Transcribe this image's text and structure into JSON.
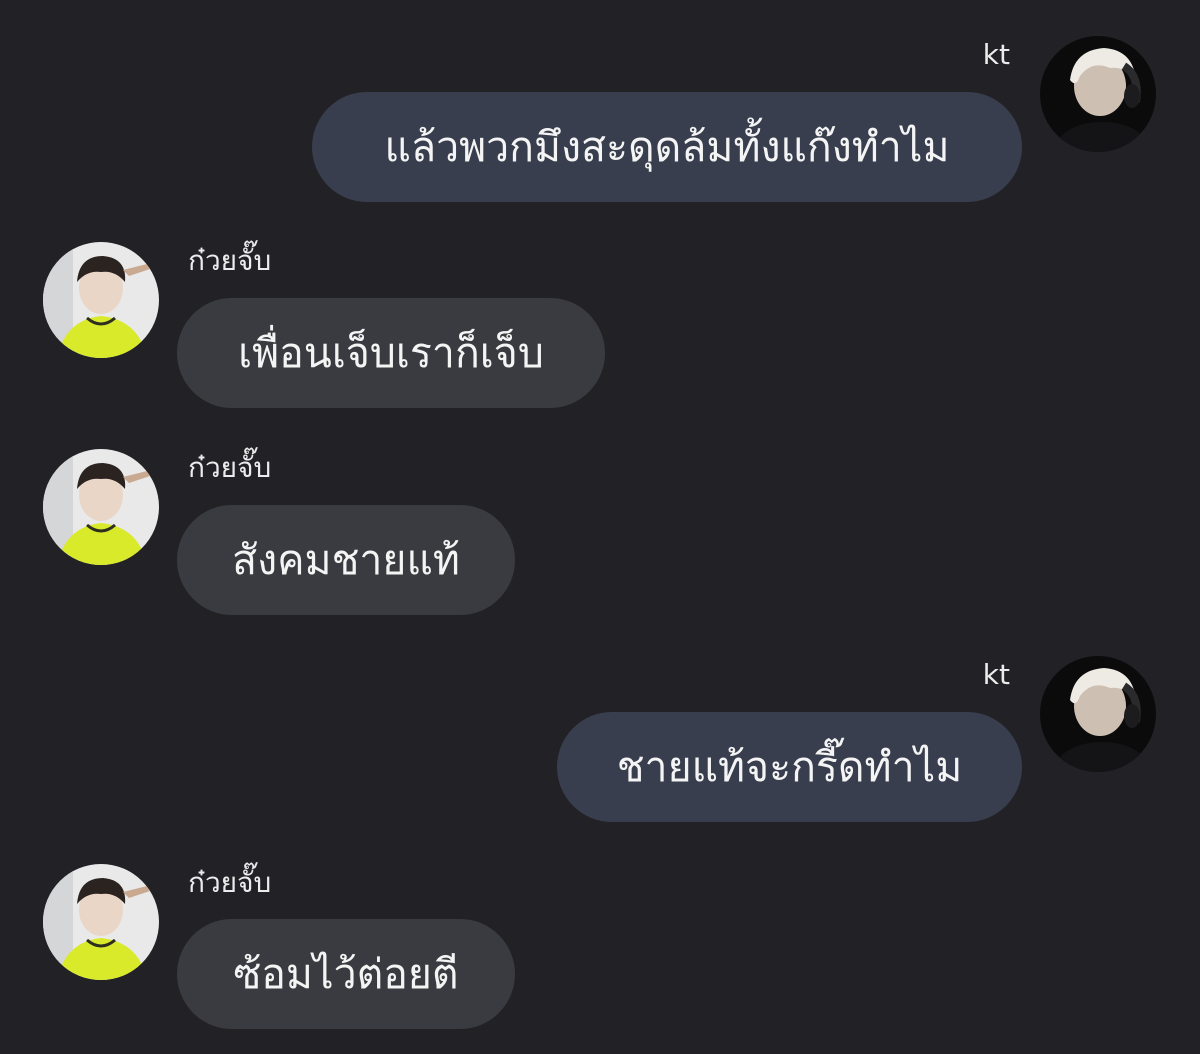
{
  "messages": [
    {
      "sender": "kt",
      "side": "right",
      "text": "แล้วพวกมึงสะดุดล้มทั้งแก๊งทำไม"
    },
    {
      "sender": "ก๋วยจั๊บ",
      "side": "left",
      "text": "เพื่อนเจ็บเราก็เจ็บ"
    },
    {
      "sender": "ก๋วยจั๊บ",
      "side": "left",
      "text": "สังคมชายแท้"
    },
    {
      "sender": "kt",
      "side": "right",
      "text": "ชายแท้จะกรี๊ดทำไม"
    },
    {
      "sender": "ก๋วยจั๊บ",
      "side": "left",
      "text": "ซ้อมไว้ต่อยตี"
    }
  ],
  "colors": {
    "background": "#222226",
    "my_bubble": "#383e4e",
    "their_bubble": "#3a3b40",
    "text": "#f4f4f4"
  },
  "avatars": {
    "kt": "profile-photo-white-hair-headphones",
    "friend": "profile-photo-yellow-shirt"
  }
}
